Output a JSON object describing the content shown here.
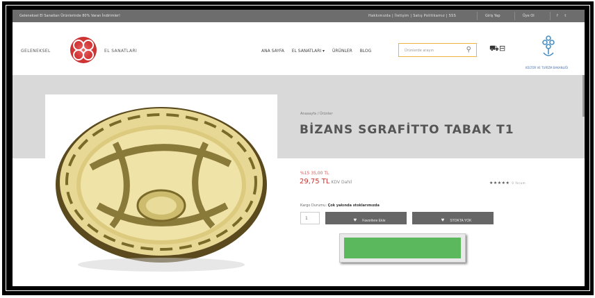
{
  "topbar": {
    "announcement": "Geleneksel El Sanatları Ürünlerinde 80% Varan İndirimler!",
    "links": "Hakkımızda | İletişim | Satış Politikamız | SSS",
    "login": "Giriş Yap",
    "member": "Üye Ol",
    "social": "f t"
  },
  "header": {
    "brand_left": "GELENEKSEL",
    "brand_right": "EL SANATLARI",
    "nav": [
      "ANA SAYFA",
      "EL SANATLARI ▾",
      "ÜRÜNLER",
      "BLOG"
    ],
    "search_placeholder": "Ürünlerde arayın",
    "ministry_text": "KÜLTÜR VE TURİZM BAKANLIĞI"
  },
  "product": {
    "breadcrumb": "Anasayfa / Ürünler",
    "title": "BİZANS SGRAFİTTO TABAK T1",
    "old_price": "%15 35,00 TL",
    "price": "29,75 TL",
    "vat": "KDV Dahil",
    "rating_stars": "★★★★★",
    "reviews": "0 Yorum",
    "delivery_label": "Kargo Durumu:",
    "delivery_value": "Çok yakında stoklarımızda",
    "quantity": "1",
    "fav_button": "Favorilere Ekle",
    "stock_button": "STOKTA YOK"
  },
  "colors": {
    "accent_green": "#5cb85c",
    "logo_red": "#d43a3a",
    "price_red": "#c9302c",
    "topbar_gray": "#6d6d6d"
  },
  "icons": [
    "search-icon",
    "cart-icon",
    "bag-icon",
    "heart-icon"
  ]
}
